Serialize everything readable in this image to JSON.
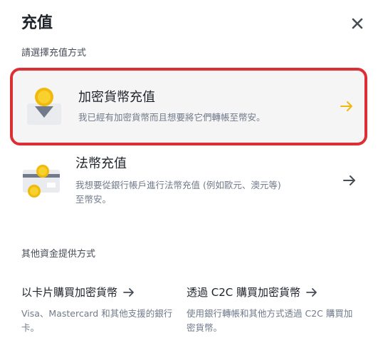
{
  "modal": {
    "title": "充值",
    "subtitle": "請選擇充值方式",
    "close_icon": "close-icon"
  },
  "options": [
    {
      "title": "加密貨幣充值",
      "description": "我已經有加密貨幣而且想要將它們轉帳至幣安。",
      "icon": "crypto-deposit-icon",
      "arrow_icon": "arrow-right-icon",
      "selected": true
    },
    {
      "title": "法幣充值",
      "description": "我想要從銀行帳戶進行法幣充值 (例如歐元、澳元等) 至幣安。",
      "icon": "fiat-deposit-icon",
      "arrow_icon": "arrow-right-icon",
      "selected": false
    }
  ],
  "other": {
    "title": "其他資金提供方式",
    "methods": [
      {
        "title": "以卡片購買加密貨幣",
        "description": "Visa、Mastercard 和其他支援的銀行卡。"
      },
      {
        "title": "透過 C2C 購買加密貨幣",
        "description": "使用銀行轉帳和其他方式透過 C2C 購買加密貨幣。"
      }
    ]
  },
  "colors": {
    "accent": "#f0b90b",
    "highlight_border": "#dc2f35",
    "text_primary": "#1e2329",
    "text_secondary": "#707a8a"
  }
}
